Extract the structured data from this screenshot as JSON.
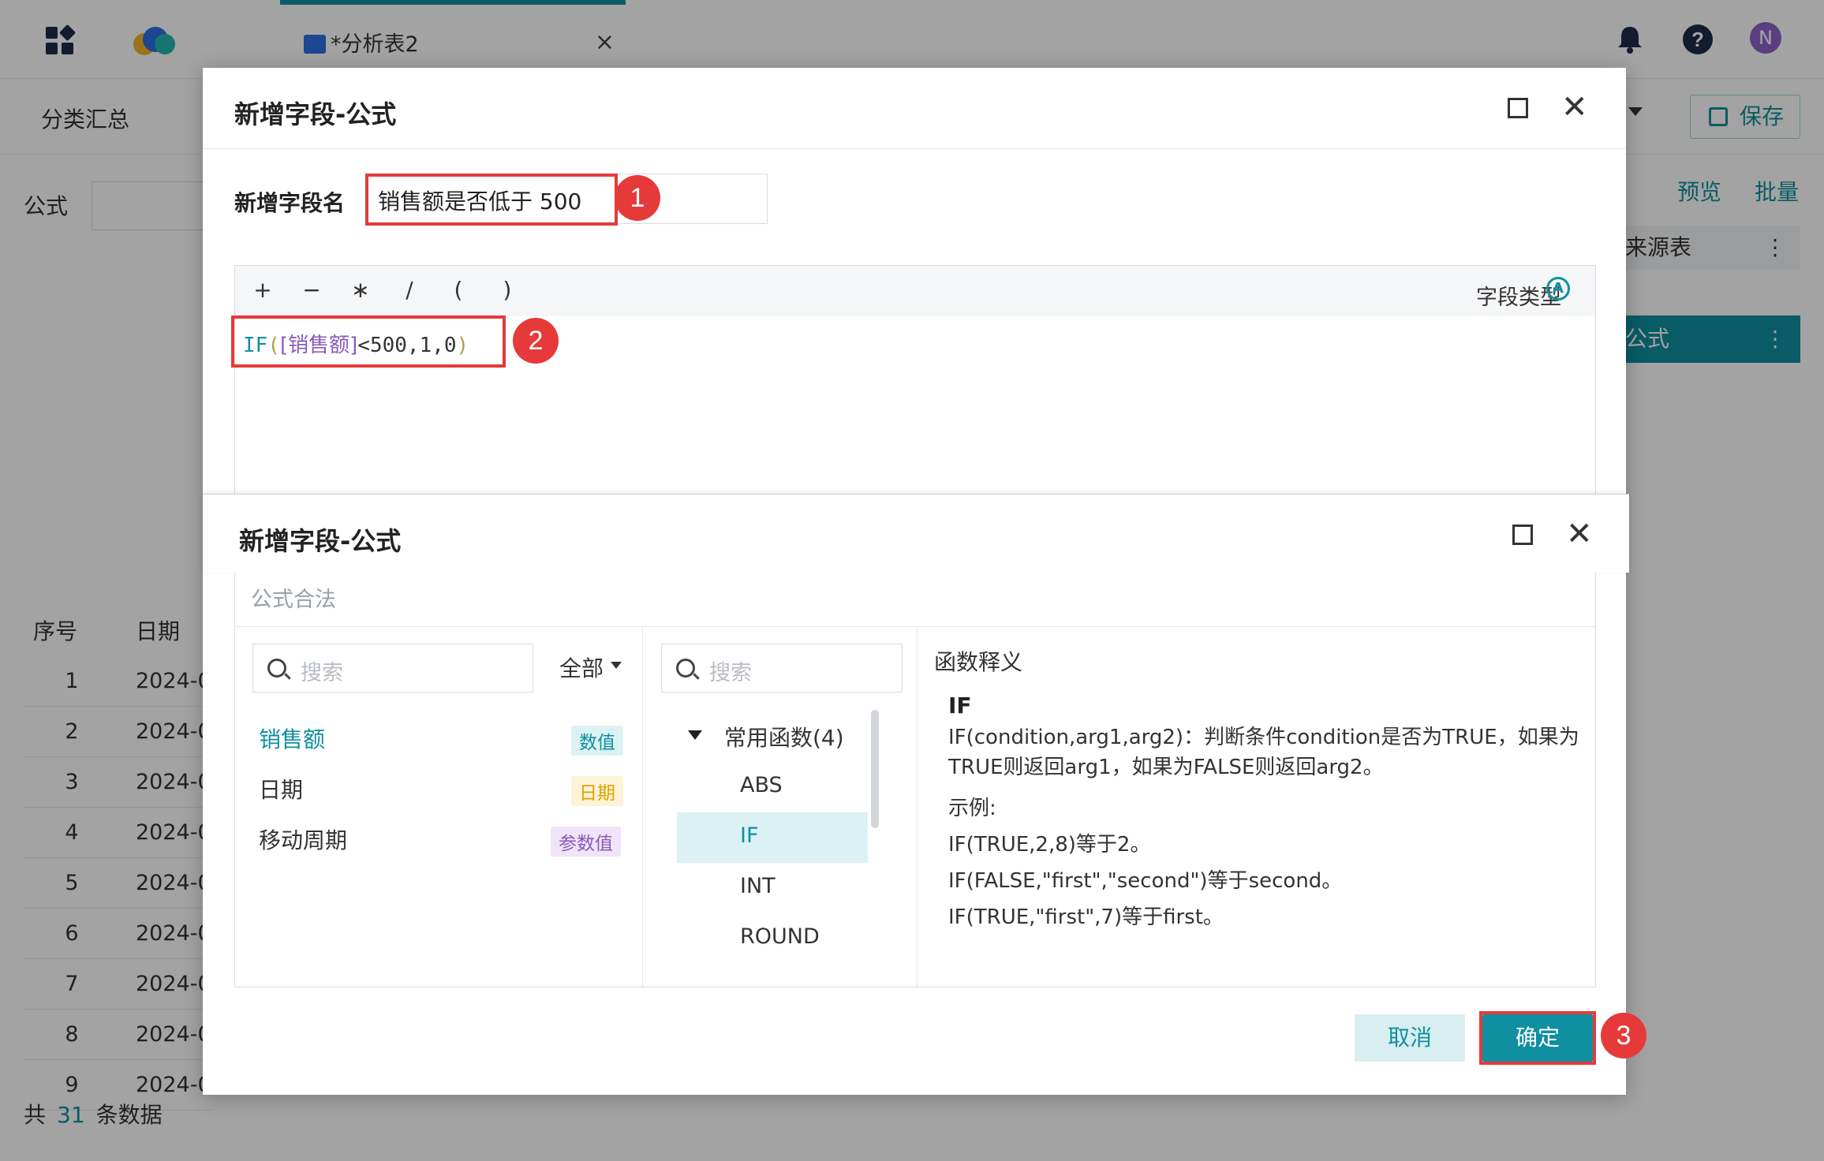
{
  "app": {
    "tab_title": "*分析表2",
    "tab_close": "×",
    "avatar_initial": "N"
  },
  "toolbar": {
    "summary": "分类汇总",
    "save": "保存"
  },
  "background": {
    "formula_label": "公式",
    "preview": "预览",
    "batch": "批量",
    "source_table": "来源表",
    "formula_row": "公式",
    "table": {
      "headers": [
        "序号",
        "日期"
      ],
      "rows": [
        {
          "seq": "1",
          "date": "2024-0"
        },
        {
          "seq": "2",
          "date": "2024-0"
        },
        {
          "seq": "3",
          "date": "2024-0"
        },
        {
          "seq": "4",
          "date": "2024-0"
        },
        {
          "seq": "5",
          "date": "2024-0"
        },
        {
          "seq": "6",
          "date": "2024-0"
        },
        {
          "seq": "7",
          "date": "2024-0"
        },
        {
          "seq": "8",
          "date": "2024-0"
        },
        {
          "seq": "9",
          "date": "2024-0"
        }
      ]
    },
    "footer_prefix": "共",
    "footer_count": "31",
    "footer_suffix": "条数据"
  },
  "dialog1": {
    "title": "新增字段-公式",
    "field_name_label": "新增字段名",
    "field_name_value": "销售额是否低于 500",
    "operators": [
      "+",
      "−",
      "∗",
      "/",
      "(",
      ")"
    ],
    "field_type_label": "字段类型",
    "field_type_icon": "A",
    "formula": {
      "func": "IF",
      "open": "(",
      "field_open": "[",
      "field": "销售额",
      "field_close": "]",
      "rest": "<500,1,0",
      "close": ")"
    },
    "cancel": "取消",
    "confirm": "确定"
  },
  "dialog2": {
    "title": "新增字段-公式",
    "legal": "公式合法",
    "fields_search_placeholder": "搜索",
    "filter_all": "全部",
    "fields": [
      {
        "name": "销售额",
        "tag": "数值",
        "active": true
      },
      {
        "name": "日期",
        "tag": "日期",
        "active": false
      },
      {
        "name": "移动周期",
        "tag": "参数值",
        "active": false
      }
    ],
    "functions_search_placeholder": "搜索",
    "function_group": "常用函数(4)",
    "functions": [
      "ABS",
      "IF",
      "INT",
      "ROUND"
    ],
    "selected_function": "IF",
    "description": {
      "title": "函数释义",
      "name": "IF",
      "lines": [
        "IF(condition,arg1,arg2)：判断条件condition是否为TRUE，如果为TRUE则返回arg1，如果为FALSE则返回arg2。",
        "示例:",
        "IF(TRUE,2,8)等于2。",
        "IF(FALSE,\"first\",\"second\")等于second。",
        "IF(TRUE,\"first\",7)等于first。"
      ]
    }
  },
  "annotations": [
    "1",
    "2",
    "3"
  ],
  "colors": {
    "accent": "#0f8f9f",
    "highlight": "#e63a3a",
    "tag_number_bg": "#dcf1f4",
    "tag_date_bg": "#fdf3d6",
    "tag_param_bg": "#efe4f8"
  }
}
